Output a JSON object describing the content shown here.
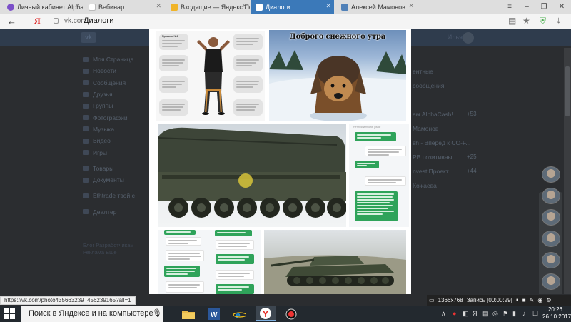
{
  "tabs": [
    {
      "title": "Личный кабинет Alpha Cas",
      "icon": "alpha-cash-favicon",
      "color": "#7b4fc9",
      "active": false
    },
    {
      "title": "Вебинар",
      "icon": "blank-favicon",
      "color": "#cfcfcf",
      "active": false
    },
    {
      "title": "Входящие — Яндекс.Почта",
      "icon": "yandex-mail-favicon",
      "color": "#f0b429",
      "active": false
    },
    {
      "title": "Диалоги",
      "icon": "vk-favicon",
      "color": "#5181b8",
      "active": true
    },
    {
      "title": "Алексей Мамонов",
      "icon": "vk-favicon",
      "color": "#5181b8",
      "active": false
    }
  ],
  "address": {
    "yandex_logo": "Я",
    "host": "vk.com",
    "title": "Диалоги"
  },
  "vk": {
    "user_name": "Илья",
    "menu": [
      {
        "label": "Моя Страница"
      },
      {
        "label": "Новости"
      },
      {
        "label": "Сообщения"
      },
      {
        "label": "Друзья"
      },
      {
        "label": "Группы"
      },
      {
        "label": "Фотографии"
      },
      {
        "label": "Музыка"
      },
      {
        "label": "Видео"
      },
      {
        "label": "Игры"
      },
      {
        "label": "Товары"
      },
      {
        "label": "Документы"
      },
      {
        "label": "Ethtrade твой с"
      },
      {
        "label": "Деалтер"
      }
    ],
    "footer": "Блог  Разработчикам\nРеклама  Ещё",
    "right_list": [
      {
        "text": "",
        "count": ""
      },
      {
        "text": "ентные",
        "count": ""
      },
      {
        "text": "сообщения",
        "count": ""
      },
      {
        "text": "",
        "count": ""
      },
      {
        "text": "ам AlphaCash!",
        "count": "+53"
      },
      {
        "text": "Мамонов",
        "count": ""
      },
      {
        "text": "sh - Вперёд к CO-F...",
        "count": ""
      },
      {
        "text": "PB позитивны...",
        "count": "+25"
      },
      {
        "text": "nvest Проект...",
        "count": "+44"
      },
      {
        "text": "Кожаева",
        "count": ""
      }
    ]
  },
  "photo": {
    "dog_caption": "Доброго снежного утра",
    "chat_header": "Нет приватности: jnsole",
    "meme_bubble_title": "Правило №1"
  },
  "status_url": "https://vk.com/photo435663239_456239165?all=1",
  "recorder": {
    "resolution": "1366x768",
    "recording": "Запись [00:00:29]"
  },
  "taskbar": {
    "search_placeholder": "Поиск в Яндексе и на компьютере",
    "time": "20:26",
    "date": "26.10.2017",
    "apps": [
      "file-explorer-icon",
      "word-icon",
      "internet-explorer-icon",
      "yandex-browser-icon",
      "record-icon"
    ]
  },
  "colors": {
    "tab_active": "#3b79b9",
    "vk_header": "#2f3c4d",
    "taskbar": "#23292f",
    "chat_green": "#2fa35a"
  }
}
